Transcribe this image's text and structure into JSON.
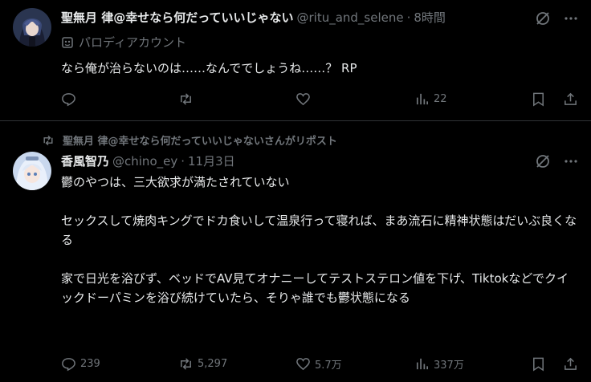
{
  "tweet1": {
    "display_name": "聖無月 律@幸せなら何だっていいじゃない",
    "handle": "@ritu_and_selene",
    "time": "8時間",
    "parody_label": "パロディアカウント",
    "text": "なら俺が治らないのは……なんででしょうね……？ RP",
    "stats": {
      "replies": "",
      "reposts": "",
      "likes": "",
      "views": "22"
    },
    "avatar_icon": "anime-character-avatar"
  },
  "tweet2": {
    "repost_context": "聖無月 律@幸せなら何だっていいじゃないさんがリポスト",
    "display_name": "香風智乃",
    "handle": "@chino_ey",
    "time": "11月3日",
    "text": "鬱のやつは、三大欲求が満たされていない\n\nセックスして焼肉キングでドカ食いして温泉行って寝れば、まあ流石に精神状態はだいぶ良くなる\n\n家で日光を浴びず、ベッドでAV見てオナニーしてテストステロン値を下げ、Tiktokなどでクイックドーパミンを浴び続けていたら、そりゃ誰でも鬱状態になる",
    "stats": {
      "replies": "239",
      "reposts": "5,297",
      "likes": "5.7万",
      "views": "337万"
    },
    "avatar_icon": "anime-character-avatar"
  },
  "colors": {
    "background": "#000000",
    "text": "#e7e9ea",
    "muted": "#71767b",
    "divider": "#2f3336"
  }
}
